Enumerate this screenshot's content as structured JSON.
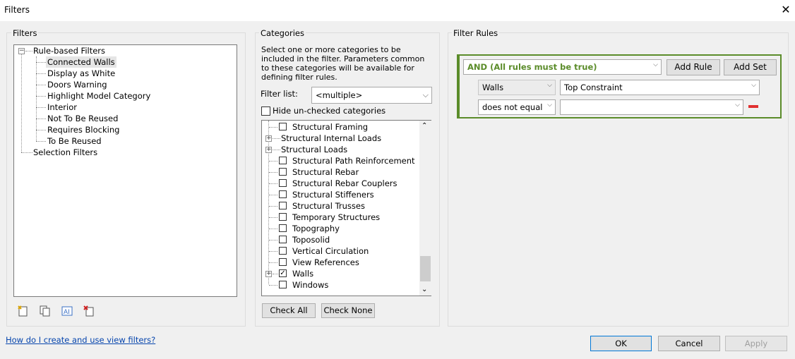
{
  "window": {
    "title": "Filters",
    "close_glyph": "✕"
  },
  "filters_panel": {
    "label": "Filters",
    "root_rule": "Rule-based Filters",
    "rule_items": [
      "Connected Walls",
      "Display as White",
      "Doors Warning",
      "Highlight Model Category",
      "Interior",
      "Not To Be Reused",
      "Requires Blocking",
      "To Be Reused"
    ],
    "selection_root": "Selection Filters",
    "selected": "Connected Walls",
    "toolbar_icons": [
      "new-filter-icon",
      "duplicate-filter-icon",
      "rename-filter-icon",
      "delete-filter-icon"
    ]
  },
  "categories_panel": {
    "label": "Categories",
    "description": "Select one or more categories to be included in the filter.  Parameters common to these categories will be available for defining filter rules.",
    "filter_list_label": "Filter list:",
    "filter_list_value": "<multiple>",
    "hide_unchecked_label": "Hide un-checked categories",
    "items": [
      {
        "label": "Structural Framing",
        "checked": false,
        "expandable": false
      },
      {
        "label": "Structural Internal Loads",
        "checked": null,
        "expandable": true
      },
      {
        "label": "Structural Loads",
        "checked": null,
        "expandable": true
      },
      {
        "label": "Structural Path Reinforcement",
        "checked": false,
        "expandable": false
      },
      {
        "label": "Structural Rebar",
        "checked": false,
        "expandable": false
      },
      {
        "label": "Structural Rebar Couplers",
        "checked": false,
        "expandable": false
      },
      {
        "label": "Structural Stiffeners",
        "checked": false,
        "expandable": false
      },
      {
        "label": "Structural Trusses",
        "checked": false,
        "expandable": false
      },
      {
        "label": "Temporary Structures",
        "checked": false,
        "expandable": false
      },
      {
        "label": "Topography",
        "checked": false,
        "expandable": false
      },
      {
        "label": "Toposolid",
        "checked": false,
        "expandable": false
      },
      {
        "label": "Vertical Circulation",
        "checked": false,
        "expandable": false
      },
      {
        "label": "View References",
        "checked": false,
        "expandable": false
      },
      {
        "label": "Walls",
        "checked": true,
        "expandable": true
      },
      {
        "label": "Windows",
        "checked": false,
        "expandable": false
      }
    ],
    "check_all": "Check All",
    "check_none": "Check None"
  },
  "rules_panel": {
    "label": "Filter Rules",
    "logic": "AND (All rules must be true)",
    "add_rule": "Add Rule",
    "add_set": "Add Set",
    "category": "Walls",
    "parameter": "Top Constraint",
    "operator": "does not equal",
    "value": "",
    "accent_color": "#5b8c2a",
    "remove_color": "#e03030"
  },
  "footer": {
    "help_link": "How do I create and use view filters?",
    "ok": "OK",
    "cancel": "Cancel",
    "apply": "Apply"
  }
}
